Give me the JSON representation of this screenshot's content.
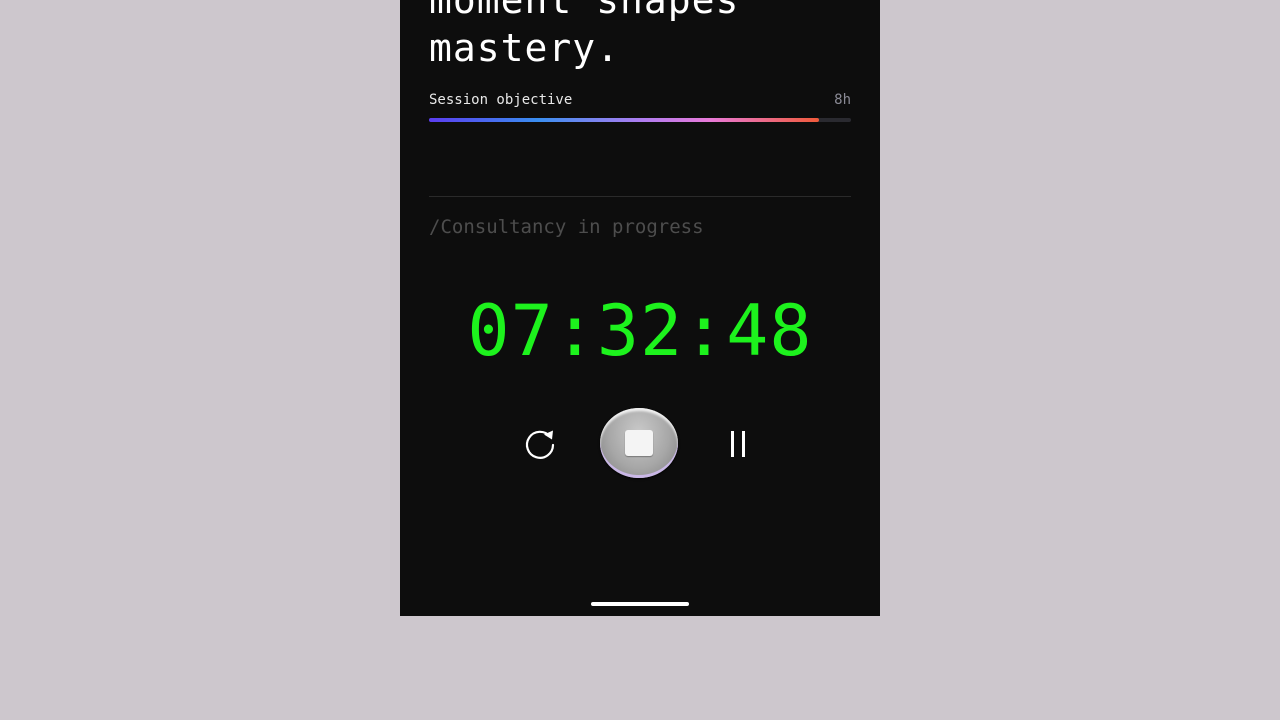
{
  "headline": {
    "line1": "moment shapes",
    "line2": "mastery."
  },
  "session": {
    "objective_label": "Session objective",
    "objective_target": "8h",
    "progress_fraction": 0.925
  },
  "status": {
    "text": "/Consultancy in progress"
  },
  "timer": {
    "value": "07:32:48"
  },
  "controls": {
    "reset_icon": "refresh-icon",
    "stop_icon": "stop-icon",
    "pause_icon": "pause-icon"
  },
  "colors": {
    "background": "#cdc7cd",
    "screen": "#0d0d0d",
    "timer": "#1df21d",
    "status_text": "#4d4d4d",
    "progress_start": "#5b3df0",
    "progress_end": "#f05a3a"
  }
}
